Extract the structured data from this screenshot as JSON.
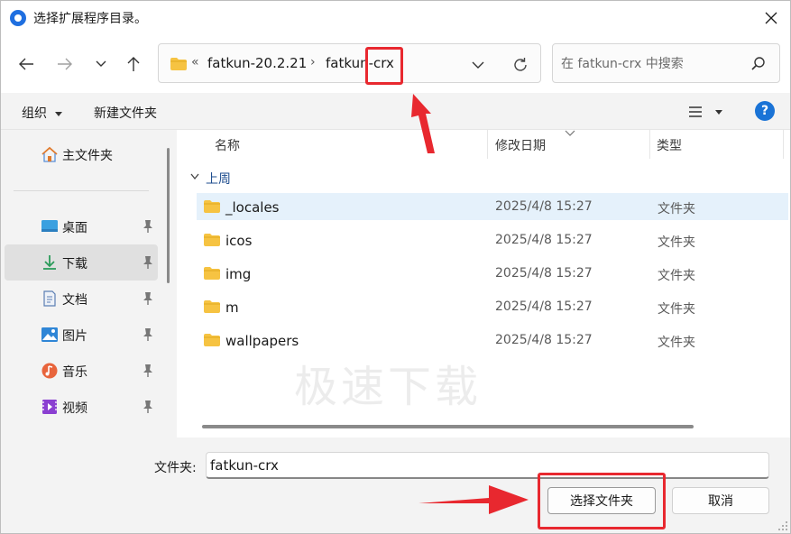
{
  "window": {
    "title": "选择扩展程序目录。"
  },
  "address": {
    "overflow_glyph": "«",
    "separator": "›",
    "crumbs": [
      "fatkun-20.2.21",
      "fatkun-crx"
    ]
  },
  "search": {
    "placeholder": "在 fatkun-crx 中搜索"
  },
  "toolbar": {
    "organize_label": "组织",
    "new_folder_label": "新建文件夹",
    "help_label": "?"
  },
  "sidebar": {
    "items": [
      {
        "label": "主文件夹",
        "icon": "home-icon",
        "pinned": false
      },
      {
        "label": "桌面",
        "icon": "desktop-icon",
        "pinned": true
      },
      {
        "label": "下载",
        "icon": "download-icon",
        "pinned": true,
        "selected": true
      },
      {
        "label": "文档",
        "icon": "document-icon",
        "pinned": true
      },
      {
        "label": "图片",
        "icon": "picture-icon",
        "pinned": true
      },
      {
        "label": "音乐",
        "icon": "music-icon",
        "pinned": true
      },
      {
        "label": "视频",
        "icon": "video-icon",
        "pinned": true
      }
    ]
  },
  "list": {
    "columns": [
      "名称",
      "修改日期",
      "类型"
    ],
    "group_label": "上周",
    "rows": [
      {
        "name": "_locales",
        "date": "2025/4/8 15:27",
        "type": "文件夹",
        "selected": true
      },
      {
        "name": "icos",
        "date": "2025/4/8 15:27",
        "type": "文件夹"
      },
      {
        "name": "img",
        "date": "2025/4/8 15:27",
        "type": "文件夹"
      },
      {
        "name": "m",
        "date": "2025/4/8 15:27",
        "type": "文件夹"
      },
      {
        "name": "wallpapers",
        "date": "2025/4/8 15:27",
        "type": "文件夹"
      }
    ]
  },
  "watermark": "极速下载",
  "footer": {
    "folder_label": "文件夹:",
    "folder_value": "fatkun-crx",
    "select_button": "选择文件夹",
    "cancel_button": "取消"
  },
  "colors": {
    "accent": "#1a73d6",
    "annotation_red": "#e8282f",
    "folder_yellow": "#f6c342",
    "selection": "#e5f1fb"
  }
}
